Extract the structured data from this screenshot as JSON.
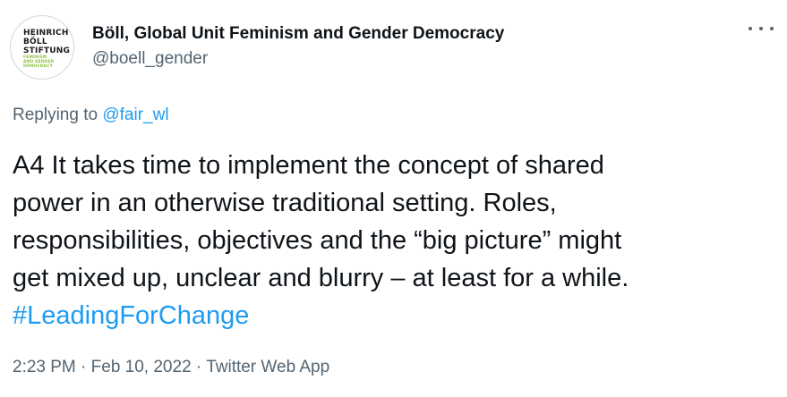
{
  "author": {
    "avatar_logo_lines": [
      "HEINRICH",
      "BÖLL",
      "STIFTUNG"
    ],
    "avatar_logo_sub_lines": [
      "FEMINISM",
      "AND GENDER",
      "DEMOCRACY"
    ],
    "display_name": "Böll, Global Unit Feminism and Gender Democracy",
    "handle": "@boell_gender"
  },
  "menu": {
    "icon": "more-horizontal-icon"
  },
  "reply": {
    "prefix": "Replying to",
    "mention": "@fair_wl"
  },
  "tweet": {
    "text": "A4 It takes time to implement the concept of shared\npower in an otherwise traditional setting. Roles,\nresponsibilities, objectives and the “big picture” might\nget mixed up, unclear and blurry – at least for a while.",
    "hashtag": "#LeadingForChange"
  },
  "meta": {
    "time": "2:23 PM",
    "date": "Feb 10, 2022",
    "source": "Twitter Web App",
    "separator": "·"
  },
  "colors": {
    "text": "#0f1419",
    "secondary": "#536471",
    "link": "#1d9bf0",
    "logo_accent": "#8dc63f"
  }
}
